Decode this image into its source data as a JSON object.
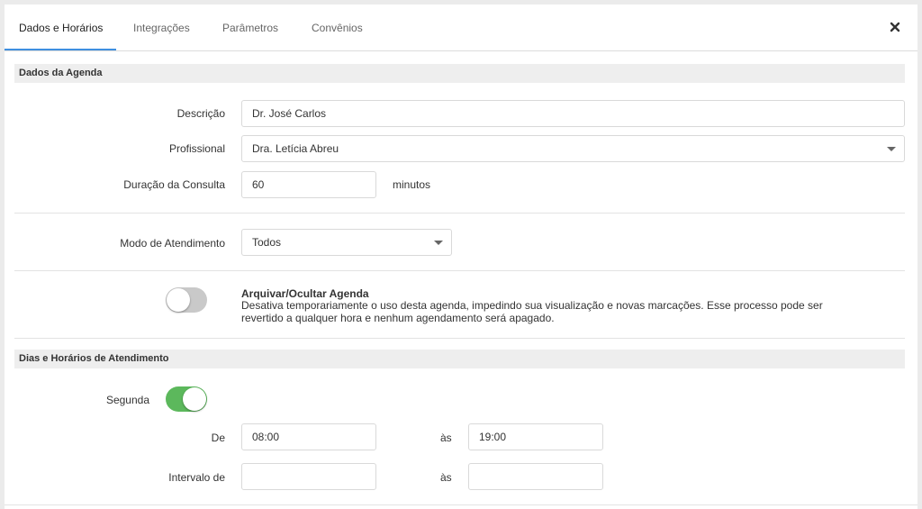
{
  "tabs": [
    {
      "label": "Dados e Horários",
      "active": true
    },
    {
      "label": "Integrações",
      "active": false
    },
    {
      "label": "Parâmetros",
      "active": false
    },
    {
      "label": "Convênios",
      "active": false
    }
  ],
  "close_icon": "close-icon",
  "accent_color": "#3f8fe0",
  "toggle_on_color": "#5cb85c",
  "dados_agenda": {
    "header": "Dados da Agenda",
    "descricao": {
      "label": "Descrição",
      "value": "Dr. José Carlos"
    },
    "profissional": {
      "label": "Profissional",
      "value": "Dra. Letícia Abreu"
    },
    "duracao": {
      "label": "Duração da Consulta",
      "value": "60",
      "unit": "minutos"
    },
    "modo": {
      "label": "Modo de Atendimento",
      "value": "Todos"
    },
    "arquivar": {
      "enabled": false,
      "title": "Arquivar/Ocultar Agenda",
      "description": "Desativa temporariamente o uso desta agenda, impedindo sua visualização e novas marcações. Esse processo pode ser revertido a qualquer hora e nenhum agendamento será apagado."
    }
  },
  "dias_horarios": {
    "header": "Dias e Horários de Atendimento",
    "segunda": {
      "label": "Segunda",
      "enabled": true,
      "de_label": "De",
      "de_value": "08:00",
      "ate_label": "às",
      "ate_value": "19:00",
      "intervalo_label": "Intervalo de",
      "intervalo_de_value": "",
      "intervalo_ate_label": "às",
      "intervalo_ate_value": ""
    }
  }
}
